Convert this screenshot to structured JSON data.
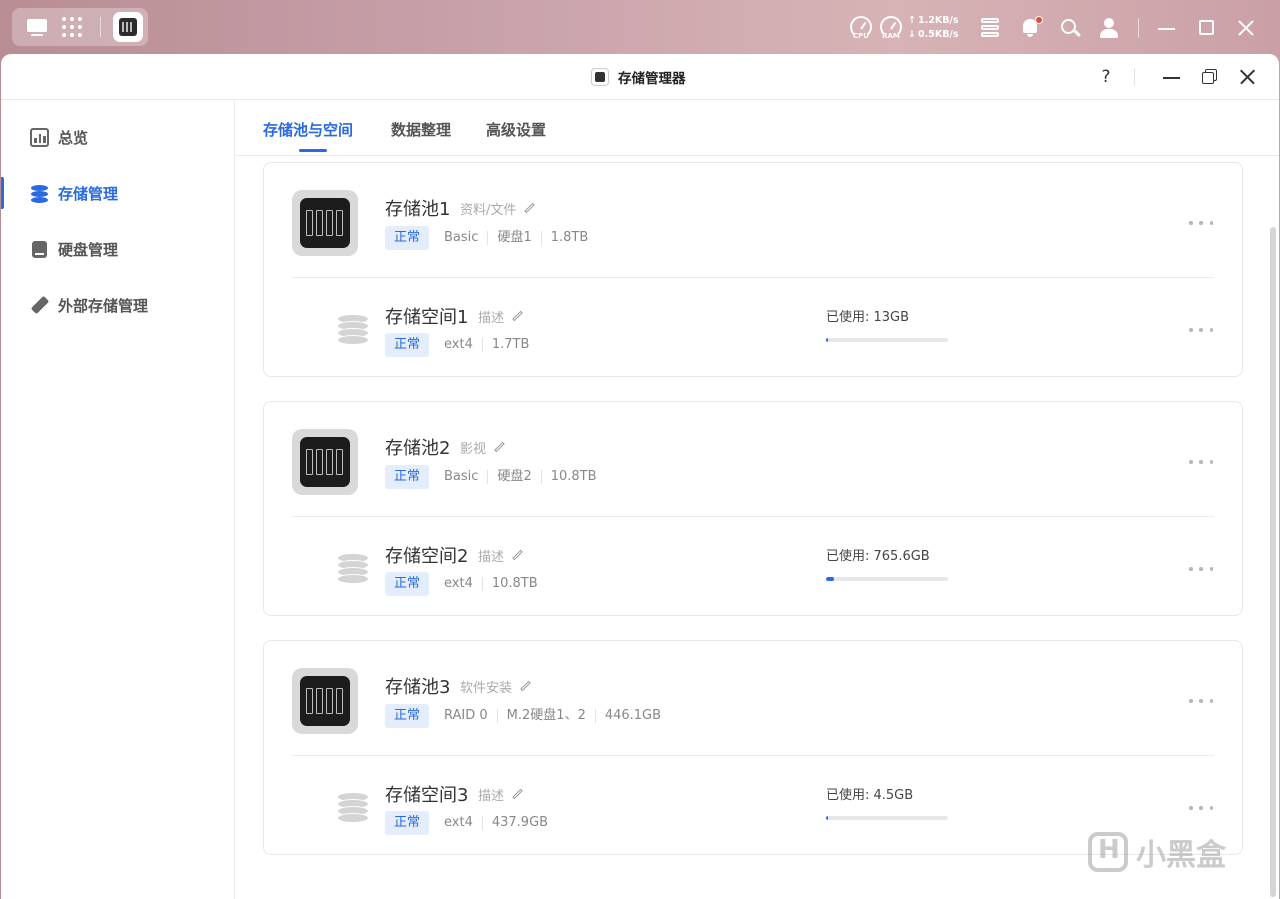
{
  "system_bar": {
    "cpu_label": "CPU",
    "ram_label": "RAM",
    "upload": "1.2KB/s",
    "download": "0.5KB/s"
  },
  "window": {
    "title": "存储管理器",
    "help": "?"
  },
  "sidebar": {
    "items": [
      {
        "label": "总览",
        "icon": "overview-icon",
        "active": false
      },
      {
        "label": "存储管理",
        "icon": "storage-icon",
        "active": true
      },
      {
        "label": "硬盘管理",
        "icon": "disk-icon",
        "active": false
      },
      {
        "label": "外部存储管理",
        "icon": "external-storage-icon",
        "active": false
      }
    ]
  },
  "tabs": [
    {
      "label": "存储池与空间",
      "active": true
    },
    {
      "label": "数据整理",
      "active": false
    },
    {
      "label": "高级设置",
      "active": false
    }
  ],
  "pools": [
    {
      "name": "存储池1",
      "desc": "资料/文件",
      "status": "正常",
      "raid": "Basic",
      "disks": "硬盘1",
      "capacity": "1.8TB",
      "volume": {
        "name": "存储空间1",
        "desc": "描述",
        "status": "正常",
        "fs": "ext4",
        "capacity": "1.7TB",
        "usage_text": "已使用: 13GB",
        "usage_fraction": 0.007
      }
    },
    {
      "name": "存储池2",
      "desc": "影视",
      "status": "正常",
      "raid": "Basic",
      "disks": "硬盘2",
      "capacity": "10.8TB",
      "volume": {
        "name": "存储空间2",
        "desc": "描述",
        "status": "正常",
        "fs": "ext4",
        "capacity": "10.8TB",
        "usage_text": "已使用: 765.6GB",
        "usage_fraction": 0.069
      }
    },
    {
      "name": "存储池3",
      "desc": "软件安装",
      "status": "正常",
      "raid": "RAID 0",
      "disks": "M.2硬盘1、2",
      "capacity": "446.1GB",
      "volume": {
        "name": "存储空间3",
        "desc": "描述",
        "status": "正常",
        "fs": "ext4",
        "capacity": "437.9GB",
        "usage_text": "已使用: 4.5GB",
        "usage_fraction": 0.01
      }
    }
  ],
  "watermark": "小黑盒",
  "colors": {
    "accent": "#2a6ae0",
    "badge_bg": "#e3edfc",
    "notification": "#e64a3b"
  }
}
